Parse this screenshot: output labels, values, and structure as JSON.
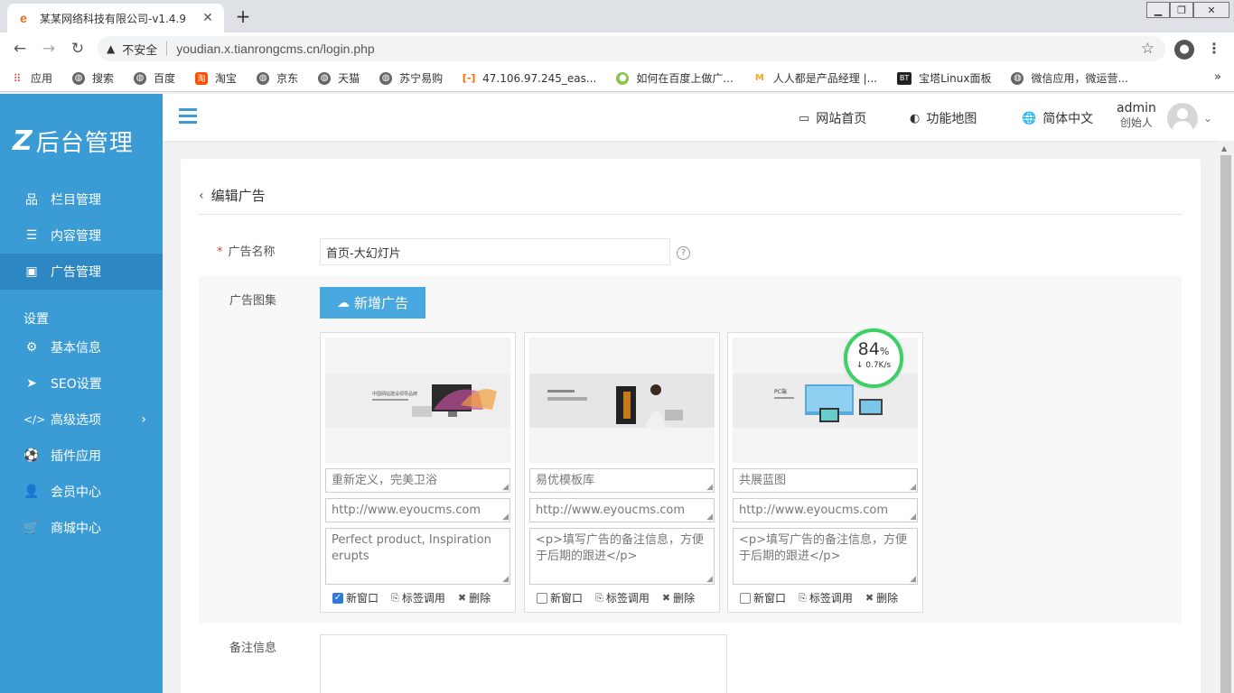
{
  "browser": {
    "tab_title": "某某网络科技有限公司-v1.4.9",
    "tab_favicon": "e",
    "insecure_label": "不安全",
    "url": "youdian.x.tianrongcms.cn/login.php"
  },
  "bookmarks": [
    {
      "label": "应用",
      "icon": "apps-grid-icon"
    },
    {
      "label": "搜索",
      "icon": "globe-icon"
    },
    {
      "label": "百度",
      "icon": "globe-icon"
    },
    {
      "label": "淘宝",
      "icon": "taobao-icon"
    },
    {
      "label": "京东",
      "icon": "globe-icon"
    },
    {
      "label": "天猫",
      "icon": "globe-icon"
    },
    {
      "label": "苏宁易购",
      "icon": "globe-icon"
    },
    {
      "label": "47.106.97.245_eas...",
      "icon": "bracket-icon"
    },
    {
      "label": "如何在百度上做广...",
      "icon": "leaf-icon"
    },
    {
      "label": "人人都是产品经理 |...",
      "icon": "mountain-icon"
    },
    {
      "label": "宝塔Linux面板",
      "icon": "bt-icon"
    },
    {
      "label": "微信应用，微运营...",
      "icon": "globe-icon"
    }
  ],
  "sidebar": {
    "logo_mark": "Z",
    "logo_text": "后台管理",
    "items": [
      {
        "label": "栏目管理",
        "icon": "sitemap-icon"
      },
      {
        "label": "内容管理",
        "icon": "list-icon"
      },
      {
        "label": "广告管理",
        "icon": "image-icon",
        "active": true
      }
    ],
    "section_label": "设置",
    "settings_items": [
      {
        "label": "基本信息",
        "icon": "gear-icon"
      },
      {
        "label": "SEO设置",
        "icon": "paper-plane-icon"
      },
      {
        "label": "高级选项",
        "icon": "code-icon",
        "has_arrow": true
      },
      {
        "label": "插件应用",
        "icon": "soccer-ball-icon"
      },
      {
        "label": "会员中心",
        "icon": "user-icon"
      },
      {
        "label": "商城中心",
        "icon": "cart-icon"
      }
    ]
  },
  "header": {
    "nav": [
      {
        "label": "网站首页",
        "icon": "monitor-icon"
      },
      {
        "label": "功能地图",
        "icon": "toggle-icon"
      },
      {
        "label": "简体中文",
        "icon": "globe-icon"
      }
    ],
    "user_name": "admin",
    "user_role": "创始人"
  },
  "page": {
    "title": "编辑广告",
    "ad_name_label": "广告名称",
    "ad_name_value": "首页-大幻灯片",
    "gallery_label": "广告图集",
    "add_button": "新增广告",
    "notes_label": "备注信息",
    "cards": [
      {
        "title": "重新定义，完美卫浴",
        "link": "http://www.eyoucms.com",
        "note": "Perfect product, Inspiration erupts",
        "new_window": true
      },
      {
        "title": "易优模板库",
        "link": "http://www.eyoucms.com",
        "note": "<p>填写广告的备注信息，方便于后期的跟进</p>",
        "new_window": false
      },
      {
        "title": "共展蓝图",
        "link": "http://www.eyoucms.com",
        "note": "<p>填写广告的备注信息，方便于后期的跟进</p>",
        "new_window": false
      }
    ],
    "card_actions": {
      "new_window": "新窗口",
      "tag_call": "标签调用",
      "delete": "删除"
    }
  },
  "speed_widget": {
    "percent": "84",
    "unit": "%",
    "rate": "0.7K/s"
  },
  "colors": {
    "sidebar": "#3a9bd5",
    "sidebar_active": "#2c87c2",
    "button": "#4aa8e0",
    "speed_ring": "#3ccf64"
  }
}
